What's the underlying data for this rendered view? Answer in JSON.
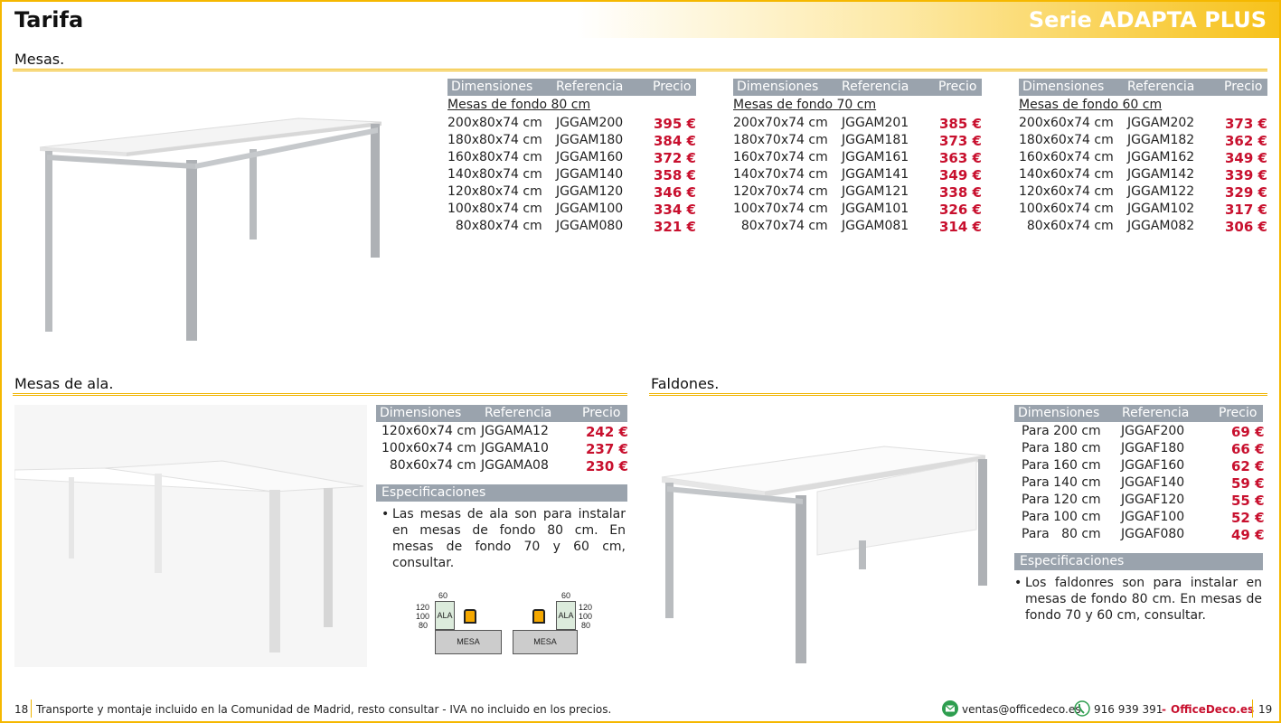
{
  "header": {
    "title": "Tarifa",
    "series": "Serie ADAPTA PLUS"
  },
  "sections": {
    "mesas": "Mesas.",
    "ala": "Mesas de ala.",
    "faldones": "Faldones."
  },
  "columns": {
    "dim": "Dimensiones",
    "ref": "Referencia",
    "price": "Precio"
  },
  "mesas_tables": [
    {
      "subtitle": "Mesas de fondo 80 cm",
      "rows": [
        [
          "200x80x74 cm",
          "JGGAM200",
          "395 €"
        ],
        [
          "180x80x74 cm",
          "JGGAM180",
          "384 €"
        ],
        [
          "160x80x74 cm",
          "JGGAM160",
          "372 €"
        ],
        [
          "140x80x74 cm",
          "JGGAM140",
          "358 €"
        ],
        [
          "120x80x74 cm",
          "JGGAM120",
          "346 €"
        ],
        [
          "100x80x74 cm",
          "JGGAM100",
          "334 €"
        ],
        [
          "  80x80x74 cm",
          "JGGAM080",
          "321 €"
        ]
      ]
    },
    {
      "subtitle": "Mesas de fondo 70 cm",
      "rows": [
        [
          "200x70x74 cm",
          "JGGAM201",
          "385 €"
        ],
        [
          "180x70x74 cm",
          "JGGAM181",
          "373 €"
        ],
        [
          "160x70x74 cm",
          "JGGAM161",
          "363 €"
        ],
        [
          "140x70x74 cm",
          "JGGAM141",
          "349 €"
        ],
        [
          "120x70x74 cm",
          "JGGAM121",
          "338 €"
        ],
        [
          "100x70x74 cm",
          "JGGAM101",
          "326 €"
        ],
        [
          "  80x70x74 cm",
          "JGGAM081",
          "314 €"
        ]
      ]
    },
    {
      "subtitle": "Mesas de fondo 60 cm",
      "rows": [
        [
          "200x60x74 cm",
          "JGGAM202",
          "373 €"
        ],
        [
          "180x60x74 cm",
          "JGGAM182",
          "362 €"
        ],
        [
          "160x60x74 cm",
          "JGGAM162",
          "349 €"
        ],
        [
          "140x60x74 cm",
          "JGGAM142",
          "339 €"
        ],
        [
          "120x60x74 cm",
          "JGGAM122",
          "329 €"
        ],
        [
          "100x60x74 cm",
          "JGGAM102",
          "317 €"
        ],
        [
          "  80x60x74 cm",
          "JGGAM082",
          "306 €"
        ]
      ]
    }
  ],
  "ala_table": {
    "rows": [
      [
        "120x60x74 cm",
        "JGGAMA12",
        "242 €"
      ],
      [
        "100x60x74 cm",
        "JGGAMA10",
        "237 €"
      ],
      [
        "  80x60x74 cm",
        "JGGAMA08",
        "230 €"
      ]
    ],
    "spec_title": "Especificaciones",
    "spec_text": "Las mesas de ala son para instalar en mesas de fondo 80 cm. En mesas de fondo 70 y 60 cm, consultar."
  },
  "ala_diagram": {
    "top": "60",
    "sizes": [
      "120",
      "100",
      "80"
    ],
    "ala": "ALA",
    "mesa": "MESA"
  },
  "faldones_table": {
    "rows": [
      [
        "Para 200 cm",
        "JGGAF200",
        "69 €"
      ],
      [
        "Para 180 cm",
        "JGGAF180",
        "66 €"
      ],
      [
        "Para 160 cm",
        "JGGAF160",
        "62 €"
      ],
      [
        "Para 140 cm",
        "JGGAF140",
        "59 €"
      ],
      [
        "Para 120 cm",
        "JGGAF120",
        "55 €"
      ],
      [
        "Para 100 cm",
        "JGGAF100",
        "52 €"
      ],
      [
        "Para   80 cm",
        "JGGAF080",
        "49 €"
      ]
    ],
    "spec_title": "Especificaciones",
    "spec_text": "Los faldonres son para instalar en mesas de fondo 80 cm. En mesas de fondo 70 y 60 cm, consultar."
  },
  "footer": {
    "page_left": "18",
    "note": "Transporte y montaje incluido en la Comunidad de Madrid, resto consultar - IVA no incluido en los precios.",
    "email": "ventas@officedeco.es",
    "phone": "916 939 391",
    "dash": "-",
    "brand": "OfficeDeco.es",
    "page_right": "19"
  },
  "colors": {
    "accent": "#f5b800",
    "price": "#c8102e",
    "table_head": "#9aa3ad"
  }
}
